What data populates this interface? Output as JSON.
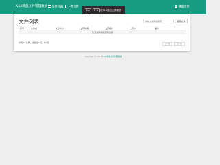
{
  "nav": {
    "brand": "XXX网盘文件管理系统",
    "file_list": "文件列表",
    "upload": "上传文件",
    "user": "数据文件"
  },
  "popover": {
    "key1": "Esc",
    "key2": "F11",
    "text": "按F11退出全屏模式"
  },
  "panel": {
    "title": "文件列表",
    "search_placeholder": "请输入文件名搜索",
    "search_button": "搜索文件",
    "columns": [
      "序号",
      "文件名",
      "文件大小",
      "上传时间",
      "上传用户",
      "上传IP",
      "操作"
    ],
    "empty_text": "暂无文件或者没有数据",
    "pagination_info": "共有0个文件，当前第1页，共0页",
    "prev": "上一页",
    "next": "下一页"
  },
  "footer": {
    "copyright": "Copyright © 2023",
    "link": "XXX网盘文件管理系统"
  },
  "colors": {
    "accent": "#179c82",
    "background": "#efefef",
    "popover": "#2b2b2b"
  }
}
